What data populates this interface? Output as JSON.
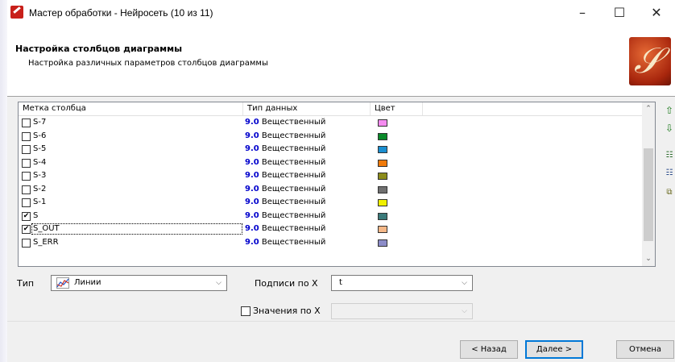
{
  "window": {
    "title": "Мастер обработки - Нейросеть (10 из 11)"
  },
  "header": {
    "title": "Настройка столбцов диаграммы",
    "subtitle": "Настройка различных параметров столбцов диаграммы",
    "logo_icon": "treble-clef-logo"
  },
  "table": {
    "columns": [
      "Метка столбца",
      "Тип данных",
      "Цвет"
    ],
    "rows": [
      {
        "label": "S-7",
        "checked": false,
        "type_code": "9.0",
        "type_name": "Вещественный",
        "color": "#f58cf0"
      },
      {
        "label": "S-6",
        "checked": false,
        "type_code": "9.0",
        "type_name": "Вещественный",
        "color": "#0a8a2a"
      },
      {
        "label": "S-5",
        "checked": false,
        "type_code": "9.0",
        "type_name": "Вещественный",
        "color": "#1a8ed0"
      },
      {
        "label": "S-4",
        "checked": false,
        "type_code": "9.0",
        "type_name": "Вещественный",
        "color": "#f07a0a"
      },
      {
        "label": "S-3",
        "checked": false,
        "type_code": "9.0",
        "type_name": "Вещественный",
        "color": "#8c8c1a"
      },
      {
        "label": "S-2",
        "checked": false,
        "type_code": "9.0",
        "type_name": "Вещественный",
        "color": "#707070"
      },
      {
        "label": "S-1",
        "checked": false,
        "type_code": "9.0",
        "type_name": "Вещественный",
        "color": "#f0f000"
      },
      {
        "label": "S",
        "checked": true,
        "type_code": "9.0",
        "type_name": "Вещественный",
        "color": "#3a7a7a"
      },
      {
        "label": "S_OUT",
        "checked": true,
        "type_code": "9.0",
        "type_name": "Вещественный",
        "color": "#f5b888"
      },
      {
        "label": "S_ERR",
        "checked": false,
        "type_code": "9.0",
        "type_name": "Вещественный",
        "color": "#8c8cc8"
      }
    ]
  },
  "options": {
    "type_label": "Тип",
    "type_value": "Линии",
    "x_labels_label": "Подписи по X",
    "x_labels_value": "t",
    "x_values_label": "Значения по X",
    "x_values_checked": false,
    "x_values_value": ""
  },
  "buttons": {
    "back": "< Назад",
    "next": "Далее >",
    "cancel": "Отмена"
  }
}
